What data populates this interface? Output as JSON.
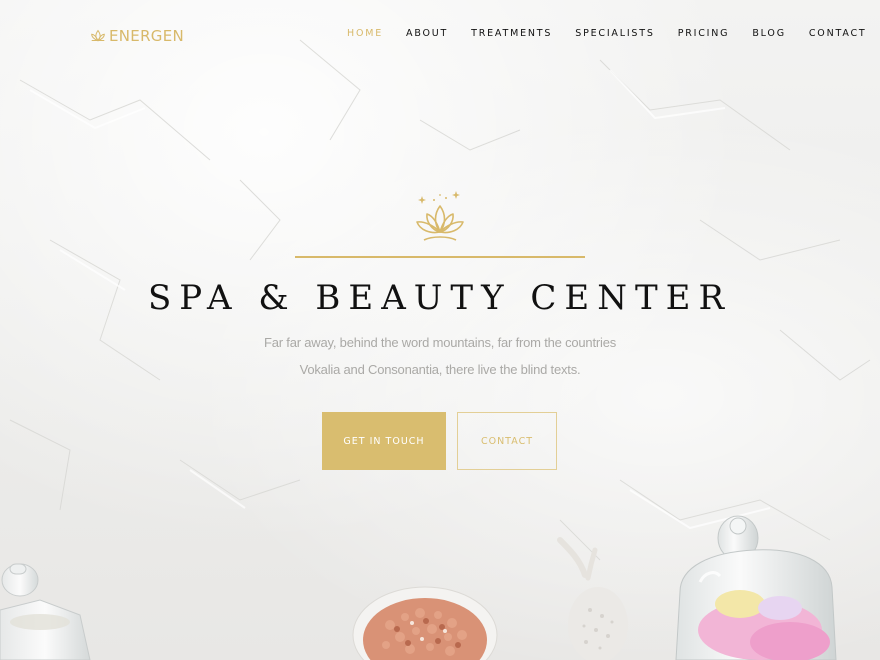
{
  "brand": {
    "name": "ENERGEN",
    "logo_icon": "lotus-icon",
    "accent_color": "#d8b96a"
  },
  "nav": {
    "items": [
      {
        "label": "HOME",
        "active": true
      },
      {
        "label": "ABOUT",
        "active": false
      },
      {
        "label": "TREATMENTS",
        "active": false
      },
      {
        "label": "SPECIALISTS",
        "active": false
      },
      {
        "label": "PRICING",
        "active": false
      },
      {
        "label": "BLOG",
        "active": false
      },
      {
        "label": "CONTACT",
        "active": false
      }
    ]
  },
  "hero": {
    "icon": "lotus-icon",
    "title": "SPA & BEAUTY CENTER",
    "subtitle_line1": "Far far away, behind the word mountains, far from the countries",
    "subtitle_line2": "Vokalia and Consonantia, there live the blind texts.",
    "primary_button": "GET IN TOUCH",
    "secondary_button": "CONTACT"
  }
}
